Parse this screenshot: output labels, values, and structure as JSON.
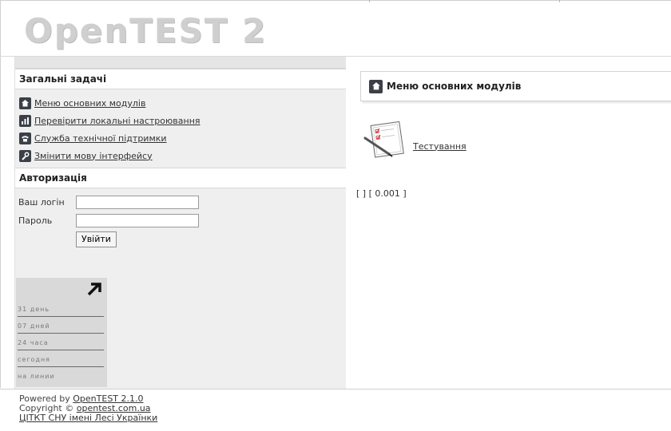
{
  "app": {
    "logo_text": "OpenTEST 2"
  },
  "sidebar": {
    "tasks_heading": "Загальні задачі",
    "tasks": [
      {
        "label": "Меню основних модулів",
        "icon": "home-icon"
      },
      {
        "label": "Перевірити локальні настроювання",
        "icon": "bar-chart-icon"
      },
      {
        "label": "Служба технічної підтримки",
        "icon": "phone-icon"
      },
      {
        "label": "Змінити мову інтерфейсу",
        "icon": "wrench-icon"
      }
    ],
    "auth_heading": "Авторизація",
    "login_label": "Ваш логін",
    "password_label": "Пароль",
    "login_value": "",
    "password_value": "",
    "submit_label": "Увійти"
  },
  "counter": {
    "rows": [
      "31 день",
      "07 дней",
      "24 часа",
      "сегодня",
      "на линии"
    ]
  },
  "main": {
    "menu_title": "Меню основних модулів",
    "modules": [
      {
        "label": "Тестування",
        "icon": "test-document-icon"
      }
    ],
    "timing_text": "[ ] [ 0.001 ]"
  },
  "footer": {
    "powered_prefix": "Powered by ",
    "powered_link": "OpenTEST 2.1.0",
    "copyright_prefix": "Copyright © ",
    "copyright_link": "opentest.com.ua",
    "org_link": "ЦІТКТ СНУ імені Лесі Українки"
  }
}
